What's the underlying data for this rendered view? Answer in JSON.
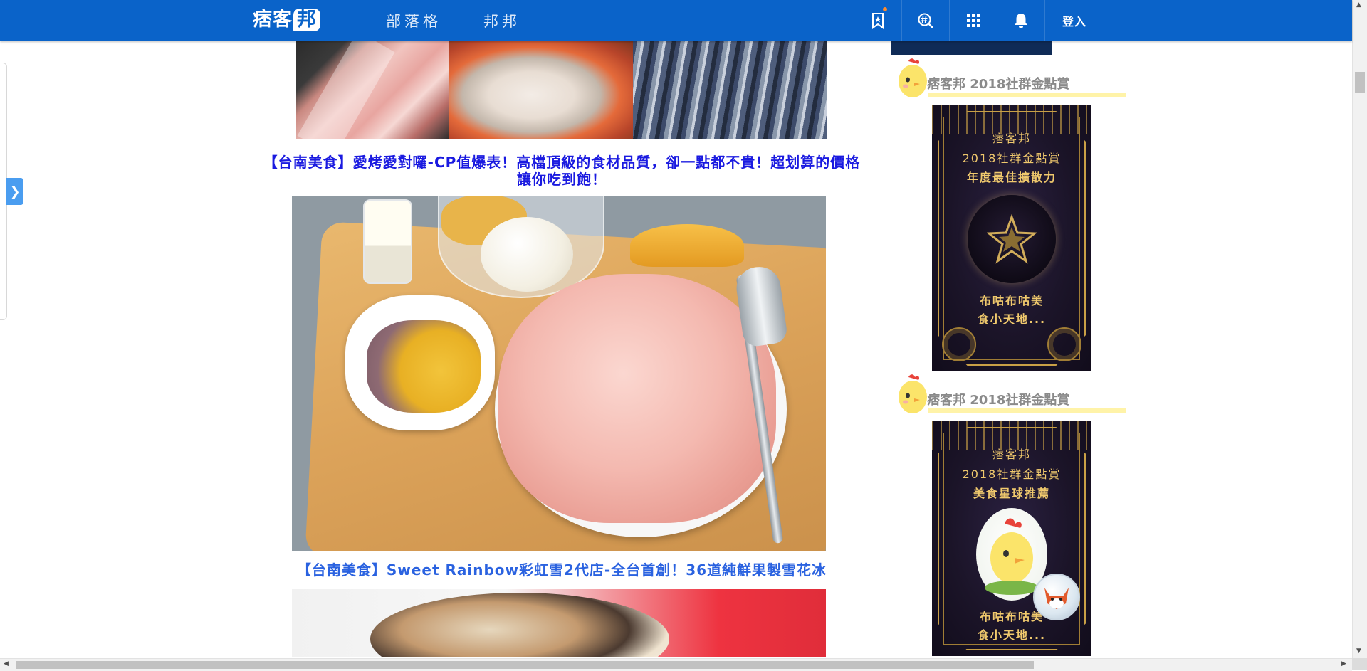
{
  "nav": {
    "logo_text": "痞客",
    "logo_mark": "邦",
    "links": [
      "部落格",
      "邦邦"
    ],
    "icons": [
      "bookmark-star-icon",
      "hashtag-search-icon",
      "apps-grid-icon",
      "bell-icon"
    ],
    "login_label": "登入",
    "accent_color": "#0a63c9"
  },
  "side_toggle": {
    "glyph": "❯"
  },
  "posts": [
    {
      "title": "【台南美食】愛烤愛對囉-CP值爆表！高檔頂級的食材品質，卻一點都不貴！超划算的價格讓你吃到飽！"
    },
    {
      "title": "【台南美食】Sweet Rainbow彩虹雪2代店-全台首創！36道純鮮果製雪花冰"
    }
  ],
  "sidebar": {
    "award_headings": [
      {
        "text": "痞客邦 2018社群金點賞"
      },
      {
        "text": "痞客邦 2018社群金點賞"
      }
    ],
    "award_cards": [
      {
        "brand": "痞客邦",
        "event": "2018社群金點賞",
        "category": "年度最佳擴散力",
        "blog_line1": "布咕布咕美",
        "blog_line2": "食小天地..."
      },
      {
        "brand": "痞客邦",
        "event": "2018社群金點賞",
        "category": "美食星球推薦",
        "blog_line1": "布咕布咕美",
        "blog_line2": "食小天地..."
      }
    ],
    "gold_color": "#f0c96d"
  }
}
